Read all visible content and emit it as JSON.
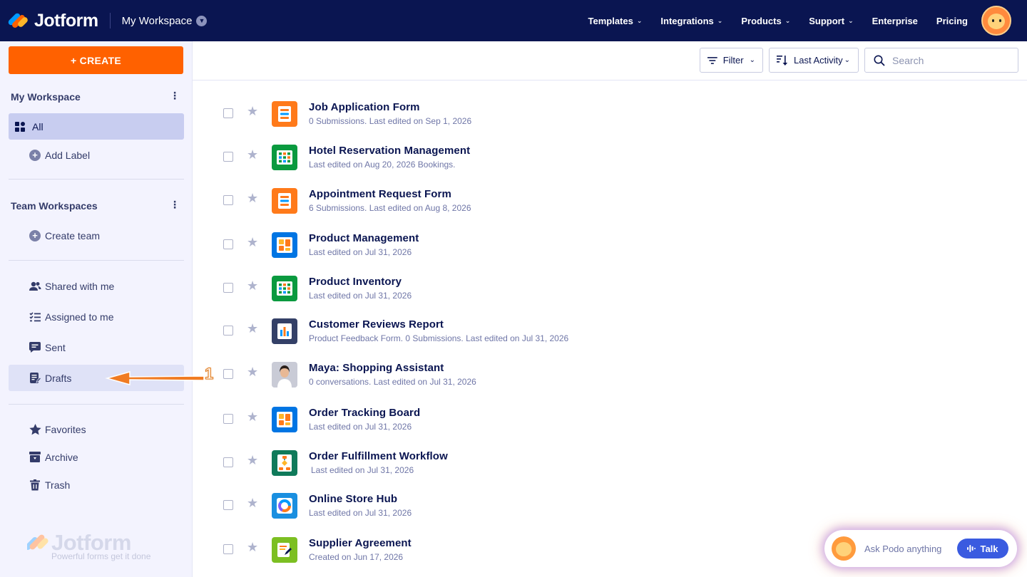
{
  "topbar": {
    "brand": "Jotform",
    "workspace": "My Workspace",
    "nav": [
      {
        "label": "Templates",
        "chevron": true
      },
      {
        "label": "Integrations",
        "chevron": true
      },
      {
        "label": "Products",
        "chevron": true
      },
      {
        "label": "Support",
        "chevron": true
      },
      {
        "label": "Enterprise",
        "chevron": false
      },
      {
        "label": "Pricing",
        "chevron": false
      }
    ]
  },
  "sidebar": {
    "create_label": "+ CREATE",
    "my_workspace_title": "My Workspace",
    "all_label": "All",
    "add_label": "Add Label",
    "team_title": "Team Workspaces",
    "create_team": "Create team",
    "items": [
      {
        "label": "Shared with me",
        "icon": "users-icon"
      },
      {
        "label": "Assigned to me",
        "icon": "checklist-icon"
      },
      {
        "label": "Sent",
        "icon": "chat-icon"
      },
      {
        "label": "Drafts",
        "icon": "draft-icon"
      },
      {
        "label": "Favorites",
        "icon": "star-icon"
      },
      {
        "label": "Archive",
        "icon": "archive-icon"
      },
      {
        "label": "Trash",
        "icon": "trash-icon"
      }
    ],
    "brand": "Jotform",
    "brand_tagline": "Powerful forms get it done"
  },
  "toolbar": {
    "filter_label": "Filter",
    "sort_label": "Last Activity",
    "search_placeholder": "Search"
  },
  "assets": [
    {
      "title": "Job Application Form",
      "subtitle": "0 Submissions. Last edited on Sep 1, 2026",
      "icon": "form-icon",
      "color": "#ff7a1a"
    },
    {
      "title": "Hotel Reservation Management",
      "subtitle": "Last edited on Aug 20, 2026 Bookings.",
      "icon": "table-icon",
      "color": "#0a9a3f"
    },
    {
      "title": "Appointment Request Form",
      "subtitle": "6 Submissions. Last edited on Aug 8, 2026",
      "icon": "form-icon",
      "color": "#ff7a1a"
    },
    {
      "title": "Product Management",
      "subtitle": "Last edited on Jul 31, 2026",
      "icon": "board-icon",
      "color": "#0075e3"
    },
    {
      "title": "Product Inventory",
      "subtitle": "Last edited on Jul 31, 2026",
      "icon": "table-icon",
      "color": "#0a9a3f"
    },
    {
      "title": "Customer Reviews Report",
      "subtitle": "Product Feedback Form. 0 Submissions. Last edited on Jul 31, 2026",
      "icon": "report-icon",
      "color": "#344067"
    },
    {
      "title": "Maya: Shopping Assistant",
      "subtitle": "0 conversations. Last edited on Jul 31, 2026",
      "icon": "agent-avatar-icon",
      "color": "#d9dbe6"
    },
    {
      "title": "Order Tracking Board",
      "subtitle": "Last edited on Jul 31, 2026",
      "icon": "board-icon",
      "color": "#0075e3"
    },
    {
      "title": "Order Fulfillment Workflow",
      "subtitle": "Last edited on Jul 31, 2026",
      "icon": "workflow-icon",
      "color": "#0f7a5a"
    },
    {
      "title": "Online Store Hub",
      "subtitle": "Last edited on Jul 31, 2026",
      "icon": "app-icon",
      "color": "#1a8fe0"
    },
    {
      "title": "Supplier Agreement",
      "subtitle": "Created on Jun 17, 2026",
      "icon": "sign-icon",
      "color": "#7cbf22"
    }
  ],
  "annotation": {
    "number": "1"
  },
  "podo": {
    "prompt": "Ask Podo anything",
    "talk_label": "Talk"
  }
}
